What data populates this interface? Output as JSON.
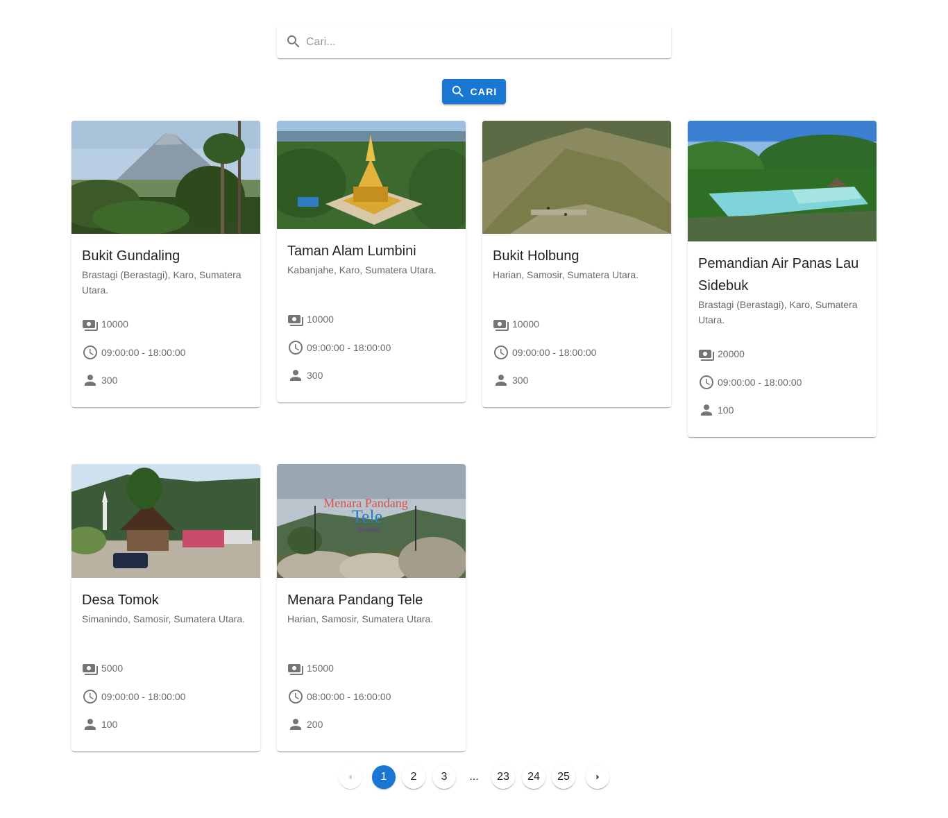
{
  "search": {
    "placeholder": "Cari...",
    "value": "",
    "button_label": "CARI",
    "accent": "#1976d2"
  },
  "cards": [
    {
      "title": "Bukit Gundaling",
      "location": "Brastagi (Berastagi), Karo, Sumatera Utara.",
      "price": "10000",
      "hours": "09:00:00 - 18:00:00",
      "capacity": "300",
      "image": "mountain-landscape-photo"
    },
    {
      "title": "Taman Alam Lumbini",
      "location": "Kabanjahe, Karo, Sumatera Utara.",
      "price": "10000",
      "hours": "09:00:00 - 18:00:00",
      "capacity": "300",
      "image": "golden-pagoda-photo"
    },
    {
      "title": "Bukit Holbung",
      "location": "Harian, Samosir, Sumatera Utara.",
      "price": "10000",
      "hours": "09:00:00 - 18:00:00",
      "capacity": "300",
      "image": "green-hill-photo"
    },
    {
      "title": "Pemandian Air Panas Lau Sidebuk",
      "location": "Brastagi (Berastagi), Karo, Sumatera Utara.",
      "price": "20000",
      "hours": "09:00:00 - 18:00:00",
      "capacity": "100",
      "image": "hot-spring-pool-photo"
    },
    {
      "title": "Desa Tomok",
      "location": "Simanindo, Samosir, Sumatera Utara.",
      "price": "5000",
      "hours": "09:00:00 - 18:00:00",
      "capacity": "100",
      "image": "traditional-village-photo"
    },
    {
      "title": "Menara Pandang Tele",
      "location": "Harian, Samosir, Sumatera Utara.",
      "price": "15000",
      "hours": "08:00:00 - 16:00:00",
      "capacity": "200",
      "image": "viewpoint-sign-photo",
      "image_text": [
        "Menara Pandang",
        "Tele",
        "Samosir"
      ]
    }
  ],
  "pagination": {
    "pages": [
      "1",
      "2",
      "3",
      "23",
      "24",
      "25"
    ],
    "current": "1",
    "ellipsis": "...",
    "prev_icon": "chevron-left-icon",
    "next_icon": "chevron-right-icon"
  }
}
